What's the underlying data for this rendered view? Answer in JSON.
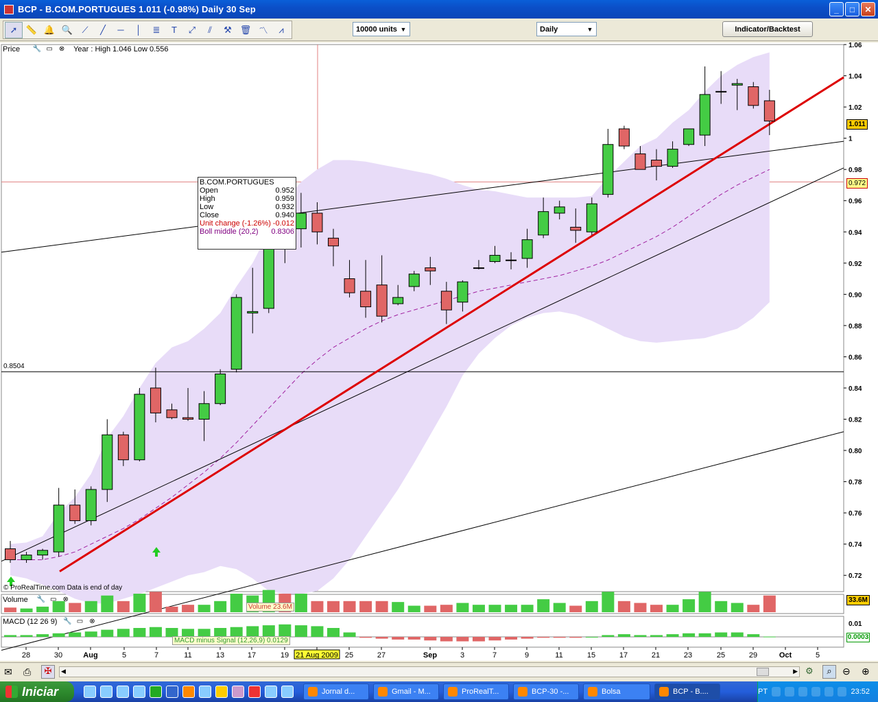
{
  "window": {
    "title": "BCP - B.COM.PORTUGUES    1.011  (-0.98%)    Daily  30 Sep",
    "buttons": [
      "_",
      "□",
      "✕"
    ]
  },
  "toolbar": {
    "tool_icons": [
      "pointer-icon",
      "ruler-icon",
      "alert-bell-icon",
      "zoom-icon",
      "segment-icon",
      "line-icon",
      "horizontal-line-icon",
      "vertical-line-icon",
      "fibonacci-icon",
      "text-icon",
      "arrows-icon",
      "channel-icon",
      "settings-icon",
      "trash-icon",
      "indicator-icon",
      "pattern-icon"
    ],
    "units_select": "10000 units",
    "period_select": "Daily",
    "indicator_button": "Indicator/Backtest"
  },
  "price_panel": {
    "label": "Price",
    "year_range": "Year : High 1.046 Low 0.556",
    "level_label": "0.8504",
    "watermark": "© ProRealTime.com  Data is end of day",
    "last_price": "1.011",
    "cursor_price": "0.972"
  },
  "tooltip": {
    "symbol": "B.COM.PORTUGUES",
    "rows": [
      {
        "label": "Open",
        "value": "0.952",
        "color": "#000000"
      },
      {
        "label": "High",
        "value": "0.959",
        "color": "#000000"
      },
      {
        "label": "Low",
        "value": "0.932",
        "color": "#000000"
      },
      {
        "label": "Close",
        "value": "0.940",
        "color": "#000000"
      },
      {
        "label": "Unit change (-1.26%)",
        "value": "-0.012",
        "color": "#cc0000"
      },
      {
        "label": "Boll middle (20,2)",
        "value": "0.8306",
        "color": "#800080"
      }
    ]
  },
  "volume_panel": {
    "label": "Volume",
    "tip": "Volume 23.6M",
    "axis_label": "33.6M"
  },
  "macd_panel": {
    "label": "MACD (12 26 9)",
    "tip": "MACD minus Signal (12,26,9) 0.0129",
    "axis_top": "0.01",
    "axis_value": "0.0003"
  },
  "date_axis": {
    "labels": [
      "28",
      "30",
      "Aug",
      "5",
      "7",
      "11",
      "13",
      "17",
      "19",
      "21 Aug 2009",
      "25",
      "27",
      "Sep",
      "3",
      "7",
      "9",
      "11",
      "15",
      "17",
      "21",
      "23",
      "25",
      "29",
      "Oct",
      "5"
    ],
    "highlight": "21 Aug 2009"
  },
  "colors": {
    "up": "#44cc44",
    "down": "#e06666",
    "band": "#e8dcf8",
    "trend": "#dd0000"
  },
  "chart_data": {
    "type": "candlestick",
    "ylim": [
      0.71,
      1.06
    ],
    "yticks": [
      0.72,
      0.74,
      0.76,
      0.78,
      0.8,
      0.82,
      0.84,
      0.86,
      0.88,
      0.9,
      0.92,
      0.94,
      0.96,
      0.98,
      1.0,
      1.02,
      1.04,
      1.06
    ],
    "candles": [
      {
        "o": 0.737,
        "h": 0.742,
        "l": 0.728,
        "c": 0.73
      },
      {
        "o": 0.73,
        "h": 0.735,
        "l": 0.728,
        "c": 0.733
      },
      {
        "o": 0.733,
        "h": 0.737,
        "l": 0.73,
        "c": 0.736
      },
      {
        "o": 0.735,
        "h": 0.776,
        "l": 0.732,
        "c": 0.765
      },
      {
        "o": 0.765,
        "h": 0.775,
        "l": 0.753,
        "c": 0.755
      },
      {
        "o": 0.755,
        "h": 0.777,
        "l": 0.752,
        "c": 0.775
      },
      {
        "o": 0.775,
        "h": 0.82,
        "l": 0.767,
        "c": 0.81
      },
      {
        "o": 0.81,
        "h": 0.812,
        "l": 0.79,
        "c": 0.794
      },
      {
        "o": 0.794,
        "h": 0.84,
        "l": 0.793,
        "c": 0.836
      },
      {
        "o": 0.84,
        "h": 0.853,
        "l": 0.818,
        "c": 0.824
      },
      {
        "o": 0.826,
        "h": 0.83,
        "l": 0.82,
        "c": 0.821
      },
      {
        "o": 0.821,
        "h": 0.84,
        "l": 0.819,
        "c": 0.82
      },
      {
        "o": 0.82,
        "h": 0.838,
        "l": 0.806,
        "c": 0.83
      },
      {
        "o": 0.83,
        "h": 0.852,
        "l": 0.829,
        "c": 0.849
      },
      {
        "o": 0.852,
        "h": 0.9,
        "l": 0.85,
        "c": 0.898
      },
      {
        "o": 0.888,
        "h": 0.917,
        "l": 0.875,
        "c": 0.889
      },
      {
        "o": 0.891,
        "h": 0.945,
        "l": 0.888,
        "c": 0.942
      },
      {
        "o": 0.935,
        "h": 0.95,
        "l": 0.92,
        "c": 0.932
      },
      {
        "o": 0.942,
        "h": 0.965,
        "l": 0.93,
        "c": 0.952
      },
      {
        "o": 0.952,
        "h": 0.959,
        "l": 0.932,
        "c": 0.94
      },
      {
        "o": 0.936,
        "h": 0.942,
        "l": 0.918,
        "c": 0.931
      },
      {
        "o": 0.91,
        "h": 0.922,
        "l": 0.898,
        "c": 0.901
      },
      {
        "o": 0.902,
        "h": 0.922,
        "l": 0.885,
        "c": 0.892
      },
      {
        "o": 0.906,
        "h": 0.925,
        "l": 0.882,
        "c": 0.886
      },
      {
        "o": 0.894,
        "h": 0.906,
        "l": 0.893,
        "c": 0.898
      },
      {
        "o": 0.905,
        "h": 0.915,
        "l": 0.902,
        "c": 0.913
      },
      {
        "o": 0.917,
        "h": 0.924,
        "l": 0.906,
        "c": 0.915
      },
      {
        "o": 0.902,
        "h": 0.908,
        "l": 0.881,
        "c": 0.89
      },
      {
        "o": 0.895,
        "h": 0.909,
        "l": 0.889,
        "c": 0.908
      },
      {
        "o": 0.917,
        "h": 0.922,
        "l": 0.916,
        "c": 0.917
      },
      {
        "o": 0.921,
        "h": 0.931,
        "l": 0.92,
        "c": 0.925
      },
      {
        "o": 0.922,
        "h": 0.927,
        "l": 0.916,
        "c": 0.922
      },
      {
        "o": 0.923,
        "h": 0.942,
        "l": 0.917,
        "c": 0.935
      },
      {
        "o": 0.938,
        "h": 0.962,
        "l": 0.936,
        "c": 0.953
      },
      {
        "o": 0.952,
        "h": 0.96,
        "l": 0.948,
        "c": 0.956
      },
      {
        "o": 0.943,
        "h": 0.955,
        "l": 0.933,
        "c": 0.941
      },
      {
        "o": 0.94,
        "h": 0.962,
        "l": 0.938,
        "c": 0.958
      },
      {
        "o": 0.964,
        "h": 1.006,
        "l": 0.962,
        "c": 0.996
      },
      {
        "o": 1.006,
        "h": 1.008,
        "l": 0.993,
        "c": 0.995
      },
      {
        "o": 0.99,
        "h": 0.995,
        "l": 0.98,
        "c": 0.98
      },
      {
        "o": 0.986,
        "h": 0.993,
        "l": 0.973,
        "c": 0.982
      },
      {
        "o": 0.982,
        "h": 0.998,
        "l": 0.981,
        "c": 0.993
      },
      {
        "o": 0.996,
        "h": 1.006,
        "l": 0.995,
        "c": 1.006
      },
      {
        "o": 1.002,
        "h": 1.046,
        "l": 0.995,
        "c": 1.028
      },
      {
        "o": 1.03,
        "h": 1.043,
        "l": 1.022,
        "c": 1.03
      },
      {
        "o": 1.034,
        "h": 1.038,
        "l": 1.018,
        "c": 1.035
      },
      {
        "o": 1.033,
        "h": 1.036,
        "l": 1.019,
        "c": 1.021
      },
      {
        "o": 1.024,
        "h": 1.031,
        "l": 1.002,
        "c": 1.011
      }
    ],
    "bollinger_upper": [
      0.74,
      0.741,
      0.745,
      0.76,
      0.77,
      0.785,
      0.808,
      0.822,
      0.84,
      0.856,
      0.866,
      0.87,
      0.878,
      0.888,
      0.905,
      0.92,
      0.94,
      0.96,
      0.972,
      0.98,
      0.986,
      0.986,
      0.985,
      0.983,
      0.981,
      0.979,
      0.977,
      0.974,
      0.97,
      0.967,
      0.966,
      0.964,
      0.962,
      0.962,
      0.962,
      0.962,
      0.963,
      0.975,
      0.985,
      0.995,
      1.0,
      1.01,
      1.018,
      1.03,
      1.04,
      1.047,
      1.052,
      1.055
    ],
    "bollinger_lower": [
      0.72,
      0.718,
      0.714,
      0.71,
      0.705,
      0.702,
      0.702,
      0.705,
      0.708,
      0.712,
      0.716,
      0.72,
      0.722,
      0.726,
      0.724,
      0.718,
      0.71,
      0.708,
      0.708,
      0.71,
      0.718,
      0.73,
      0.745,
      0.76,
      0.775,
      0.792,
      0.81,
      0.828,
      0.848,
      0.862,
      0.872,
      0.88,
      0.885,
      0.888,
      0.889,
      0.887,
      0.883,
      0.878,
      0.873,
      0.87,
      0.869,
      0.87,
      0.871,
      0.872,
      0.875,
      0.878,
      0.885,
      0.895
    ],
    "bollinger_middle": [
      0.73,
      0.73,
      0.73,
      0.732,
      0.735,
      0.74,
      0.745,
      0.75,
      0.756,
      0.763,
      0.77,
      0.778,
      0.786,
      0.795,
      0.805,
      0.816,
      0.827,
      0.838,
      0.849,
      0.858,
      0.866,
      0.872,
      0.878,
      0.883,
      0.887,
      0.89,
      0.893,
      0.896,
      0.899,
      0.902,
      0.904,
      0.906,
      0.908,
      0.91,
      0.912,
      0.915,
      0.918,
      0.922,
      0.927,
      0.932,
      0.937,
      0.943,
      0.95,
      0.957,
      0.964,
      0.97,
      0.975,
      0.98
    ],
    "volume": [
      0.25,
      0.2,
      0.3,
      0.6,
      0.5,
      0.6,
      0.9,
      0.6,
      1.0,
      1.1,
      0.3,
      0.4,
      0.4,
      0.6,
      1.0,
      0.9,
      1.2,
      1.0,
      1.0,
      0.6,
      0.6,
      0.6,
      0.6,
      0.6,
      0.55,
      0.35,
      0.35,
      0.4,
      0.5,
      0.4,
      0.4,
      0.4,
      0.4,
      0.7,
      0.5,
      0.35,
      0.6,
      1.1,
      0.6,
      0.5,
      0.4,
      0.4,
      0.7,
      1.1,
      0.6,
      0.5,
      0.4,
      0.9
    ],
    "macd_hist": [
      0.002,
      0.002,
      0.003,
      0.004,
      0.005,
      0.006,
      0.008,
      0.009,
      0.01,
      0.011,
      0.01,
      0.009,
      0.009,
      0.01,
      0.011,
      0.012,
      0.013,
      0.014,
      0.013,
      0.012,
      0.01,
      0.005,
      -0.001,
      -0.002,
      -0.003,
      -0.003,
      -0.004,
      -0.005,
      -0.005,
      -0.005,
      -0.004,
      -0.003,
      -0.002,
      -0.001,
      -0.001,
      -0.001,
      0.0,
      0.002,
      0.003,
      0.002,
      0.002,
      0.003,
      0.004,
      0.004,
      0.005,
      0.005,
      0.003,
      0.0003
    ]
  }
}
